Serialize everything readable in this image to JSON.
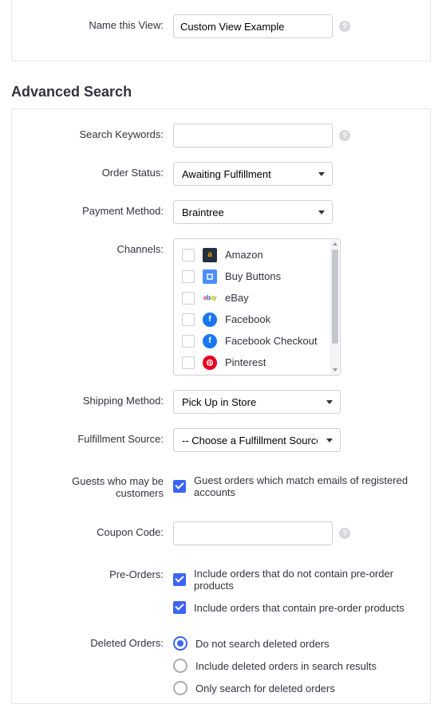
{
  "top": {
    "name_view_label": "Name this View:",
    "name_view_value": "Custom View Example"
  },
  "section_title": "Advanced Search",
  "labels": {
    "search_keywords": "Search Keywords:",
    "order_status": "Order Status:",
    "payment_method": "Payment Method:",
    "channels": "Channels:",
    "shipping_method": "Shipping Method:",
    "fulfillment_source": "Fulfillment Source:",
    "guests": "Guests who may be customers",
    "coupon_code": "Coupon Code:",
    "pre_orders": "Pre-Orders:",
    "deleted_orders": "Deleted Orders:"
  },
  "fields": {
    "search_keywords": "",
    "order_status": "Awaiting Fulfillment",
    "payment_method": "Braintree",
    "shipping_method": "Pick Up in Store",
    "fulfillment_source": "-- Choose a Fulfillment Source --",
    "coupon_code": ""
  },
  "channels": [
    {
      "label": "Amazon",
      "icon": "amazon"
    },
    {
      "label": "Buy Buttons",
      "icon": "buybuttons"
    },
    {
      "label": "eBay",
      "icon": "ebay"
    },
    {
      "label": "Facebook",
      "icon": "facebook"
    },
    {
      "label": "Facebook Checkout",
      "icon": "facebook"
    },
    {
      "label": "Pinterest",
      "icon": "pinterest"
    }
  ],
  "guests_checkbox": {
    "label": "Guest orders which match emails of registered accounts",
    "checked": true
  },
  "pre_orders": [
    {
      "label": "Include orders that do not contain pre-order products",
      "checked": true
    },
    {
      "label": "Include orders that contain pre-order products",
      "checked": true
    }
  ],
  "deleted_orders": [
    {
      "label": "Do not search deleted orders",
      "selected": true
    },
    {
      "label": "Include deleted orders in search results",
      "selected": false
    },
    {
      "label": "Only search for deleted orders",
      "selected": false
    }
  ]
}
